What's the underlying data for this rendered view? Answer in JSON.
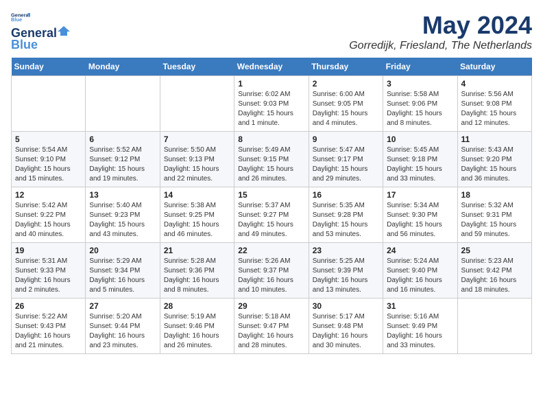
{
  "logo": {
    "line1": "General",
    "line2": "Blue"
  },
  "title": "May 2024",
  "subtitle": "Gorredijk, Friesland, The Netherlands",
  "calendar": {
    "headers": [
      "Sunday",
      "Monday",
      "Tuesday",
      "Wednesday",
      "Thursday",
      "Friday",
      "Saturday"
    ],
    "rows": [
      [
        {
          "day": "",
          "info": ""
        },
        {
          "day": "",
          "info": ""
        },
        {
          "day": "",
          "info": ""
        },
        {
          "day": "1",
          "info": "Sunrise: 6:02 AM\nSunset: 9:03 PM\nDaylight: 15 hours\nand 1 minute."
        },
        {
          "day": "2",
          "info": "Sunrise: 6:00 AM\nSunset: 9:05 PM\nDaylight: 15 hours\nand 4 minutes."
        },
        {
          "day": "3",
          "info": "Sunrise: 5:58 AM\nSunset: 9:06 PM\nDaylight: 15 hours\nand 8 minutes."
        },
        {
          "day": "4",
          "info": "Sunrise: 5:56 AM\nSunset: 9:08 PM\nDaylight: 15 hours\nand 12 minutes."
        }
      ],
      [
        {
          "day": "5",
          "info": "Sunrise: 5:54 AM\nSunset: 9:10 PM\nDaylight: 15 hours\nand 15 minutes."
        },
        {
          "day": "6",
          "info": "Sunrise: 5:52 AM\nSunset: 9:12 PM\nDaylight: 15 hours\nand 19 minutes."
        },
        {
          "day": "7",
          "info": "Sunrise: 5:50 AM\nSunset: 9:13 PM\nDaylight: 15 hours\nand 22 minutes."
        },
        {
          "day": "8",
          "info": "Sunrise: 5:49 AM\nSunset: 9:15 PM\nDaylight: 15 hours\nand 26 minutes."
        },
        {
          "day": "9",
          "info": "Sunrise: 5:47 AM\nSunset: 9:17 PM\nDaylight: 15 hours\nand 29 minutes."
        },
        {
          "day": "10",
          "info": "Sunrise: 5:45 AM\nSunset: 9:18 PM\nDaylight: 15 hours\nand 33 minutes."
        },
        {
          "day": "11",
          "info": "Sunrise: 5:43 AM\nSunset: 9:20 PM\nDaylight: 15 hours\nand 36 minutes."
        }
      ],
      [
        {
          "day": "12",
          "info": "Sunrise: 5:42 AM\nSunset: 9:22 PM\nDaylight: 15 hours\nand 40 minutes."
        },
        {
          "day": "13",
          "info": "Sunrise: 5:40 AM\nSunset: 9:23 PM\nDaylight: 15 hours\nand 43 minutes."
        },
        {
          "day": "14",
          "info": "Sunrise: 5:38 AM\nSunset: 9:25 PM\nDaylight: 15 hours\nand 46 minutes."
        },
        {
          "day": "15",
          "info": "Sunrise: 5:37 AM\nSunset: 9:27 PM\nDaylight: 15 hours\nand 49 minutes."
        },
        {
          "day": "16",
          "info": "Sunrise: 5:35 AM\nSunset: 9:28 PM\nDaylight: 15 hours\nand 53 minutes."
        },
        {
          "day": "17",
          "info": "Sunrise: 5:34 AM\nSunset: 9:30 PM\nDaylight: 15 hours\nand 56 minutes."
        },
        {
          "day": "18",
          "info": "Sunrise: 5:32 AM\nSunset: 9:31 PM\nDaylight: 15 hours\nand 59 minutes."
        }
      ],
      [
        {
          "day": "19",
          "info": "Sunrise: 5:31 AM\nSunset: 9:33 PM\nDaylight: 16 hours\nand 2 minutes."
        },
        {
          "day": "20",
          "info": "Sunrise: 5:29 AM\nSunset: 9:34 PM\nDaylight: 16 hours\nand 5 minutes."
        },
        {
          "day": "21",
          "info": "Sunrise: 5:28 AM\nSunset: 9:36 PM\nDaylight: 16 hours\nand 8 minutes."
        },
        {
          "day": "22",
          "info": "Sunrise: 5:26 AM\nSunset: 9:37 PM\nDaylight: 16 hours\nand 10 minutes."
        },
        {
          "day": "23",
          "info": "Sunrise: 5:25 AM\nSunset: 9:39 PM\nDaylight: 16 hours\nand 13 minutes."
        },
        {
          "day": "24",
          "info": "Sunrise: 5:24 AM\nSunset: 9:40 PM\nDaylight: 16 hours\nand 16 minutes."
        },
        {
          "day": "25",
          "info": "Sunrise: 5:23 AM\nSunset: 9:42 PM\nDaylight: 16 hours\nand 18 minutes."
        }
      ],
      [
        {
          "day": "26",
          "info": "Sunrise: 5:22 AM\nSunset: 9:43 PM\nDaylight: 16 hours\nand 21 minutes."
        },
        {
          "day": "27",
          "info": "Sunrise: 5:20 AM\nSunset: 9:44 PM\nDaylight: 16 hours\nand 23 minutes."
        },
        {
          "day": "28",
          "info": "Sunrise: 5:19 AM\nSunset: 9:46 PM\nDaylight: 16 hours\nand 26 minutes."
        },
        {
          "day": "29",
          "info": "Sunrise: 5:18 AM\nSunset: 9:47 PM\nDaylight: 16 hours\nand 28 minutes."
        },
        {
          "day": "30",
          "info": "Sunrise: 5:17 AM\nSunset: 9:48 PM\nDaylight: 16 hours\nand 30 minutes."
        },
        {
          "day": "31",
          "info": "Sunrise: 5:16 AM\nSunset: 9:49 PM\nDaylight: 16 hours\nand 33 minutes."
        },
        {
          "day": "",
          "info": ""
        }
      ]
    ]
  }
}
